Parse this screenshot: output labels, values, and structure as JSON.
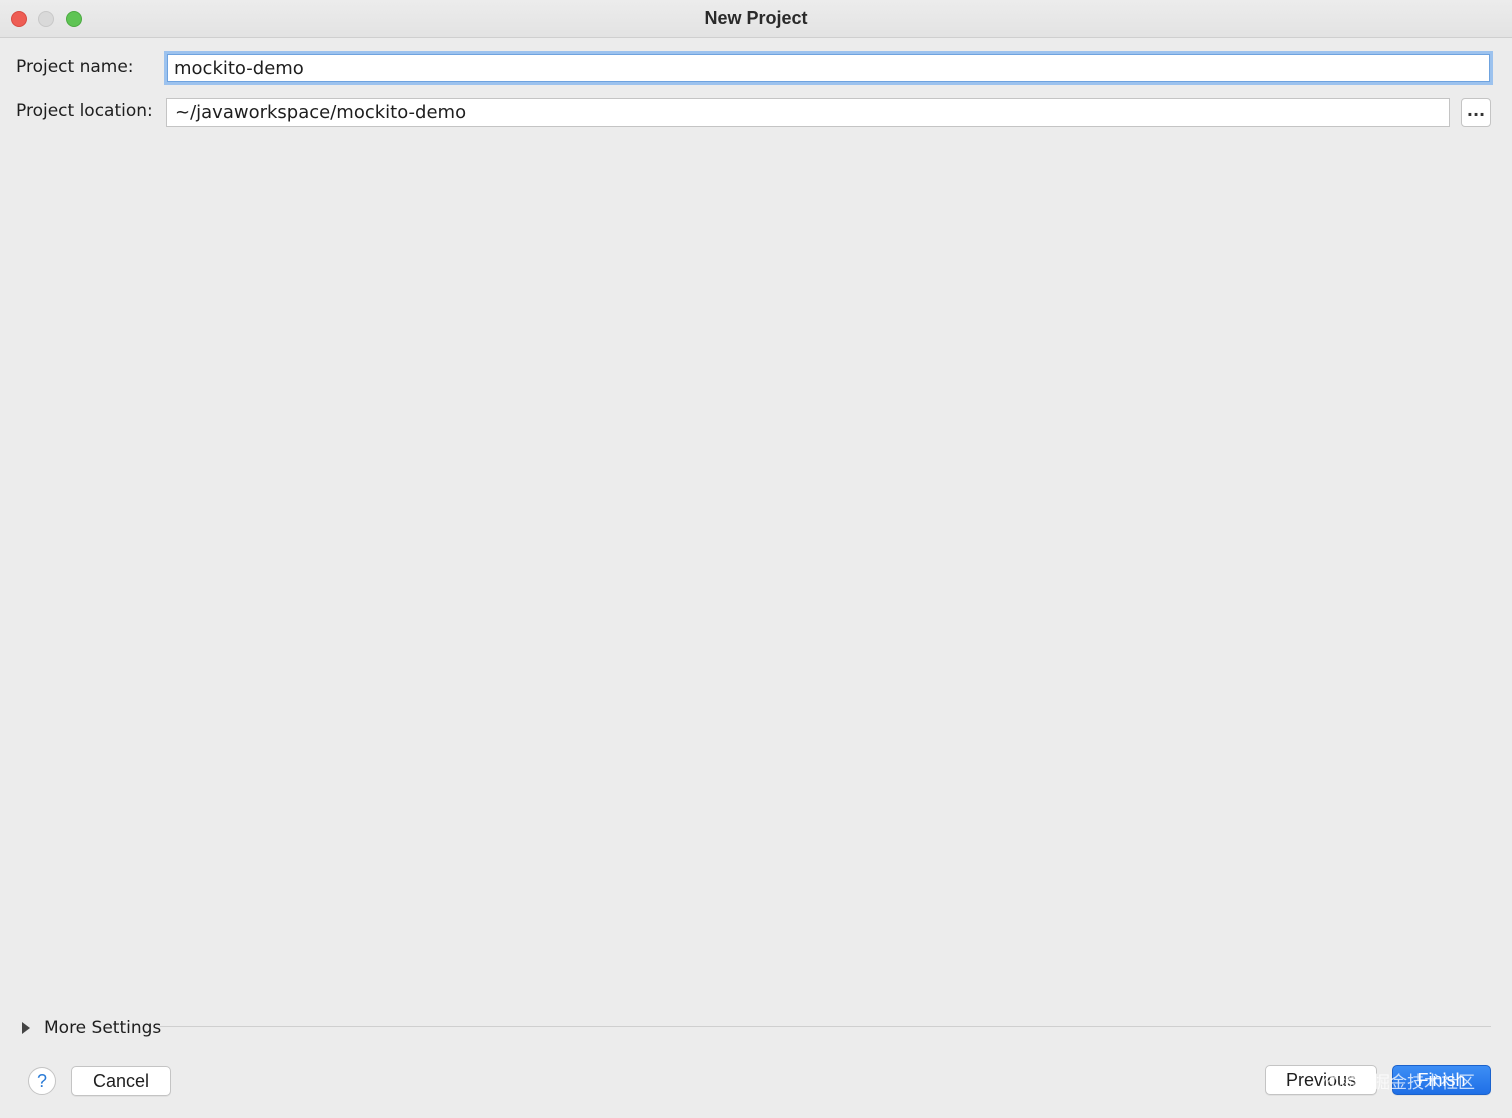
{
  "window": {
    "title": "New Project"
  },
  "form": {
    "project_name_label": "Project name:",
    "project_name_value": "mockito-demo",
    "project_location_label": "Project location:",
    "project_location_value": "~/javaworkspace/mockito-demo",
    "browse_label": "..."
  },
  "more_settings": {
    "label": "More Settings"
  },
  "footer": {
    "help_label": "?",
    "cancel_label": "Cancel",
    "previous_label": "Previous",
    "finish_label": "Finish"
  },
  "watermark": {
    "text": "@稀土掘金技术社区"
  },
  "colors": {
    "accent": "#2a7bd6",
    "finish_button": "#1f6fe6",
    "focus_ring": "#9cc2ee",
    "close": "#ee5d54",
    "minimize": "#d9d9d9",
    "maximize": "#5fc454"
  },
  "icons": {
    "close": "close-dot-icon",
    "minimize": "minimize-dot-icon",
    "maximize": "zoom-dot-icon",
    "expander": "disclosure-triangle-icon",
    "help": "help-icon"
  }
}
